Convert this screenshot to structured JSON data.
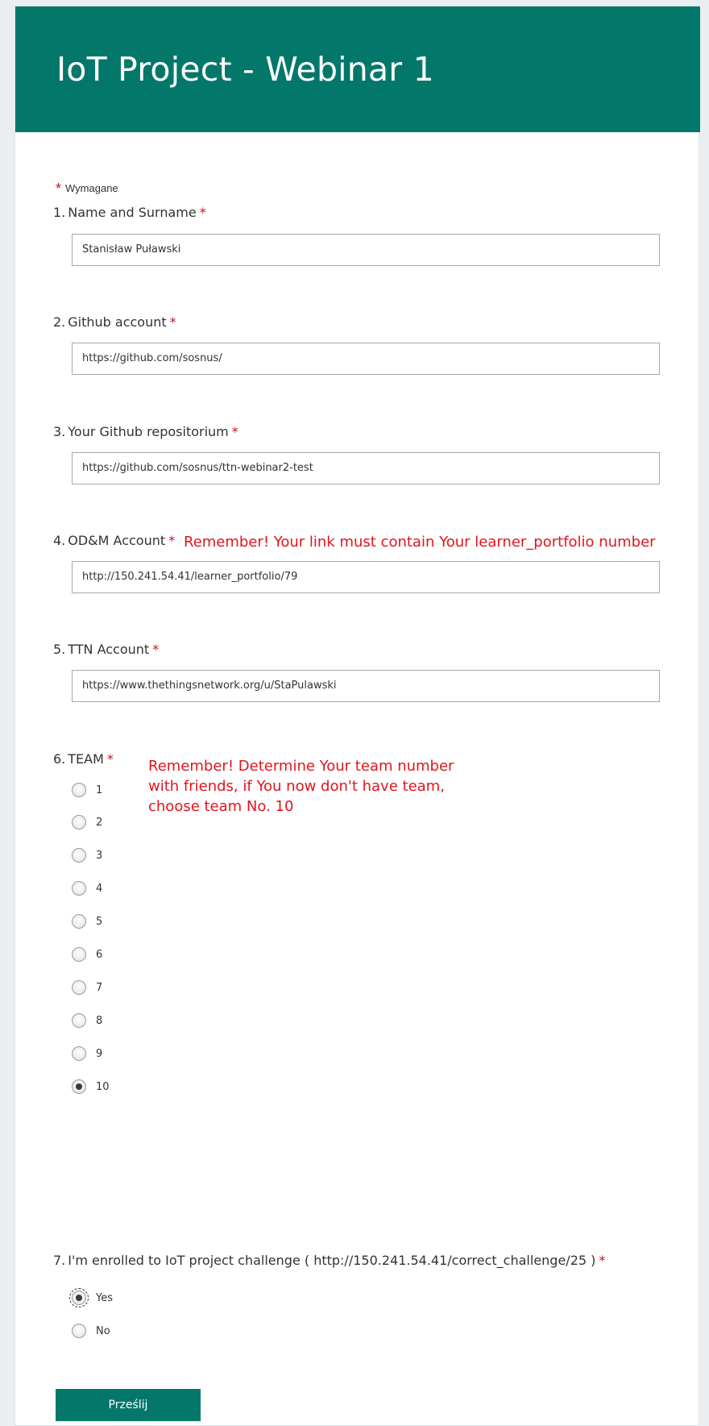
{
  "form": {
    "title": "IoT Project - Webinar 1",
    "required_text": "Wymagane",
    "required_star": "*"
  },
  "questions": [
    {
      "number": "1.",
      "label": "Name and Surname",
      "value": "Stanisław Puławski"
    },
    {
      "number": "2.",
      "label": "Github account",
      "value": "https://github.com/sosnus/"
    },
    {
      "number": "3.",
      "label": "Your Github repositorium",
      "value": "https://github.com/sosnus/ttn-webinar2-test"
    },
    {
      "number": "4.",
      "label": "OD&M Account",
      "value": "http://150.241.54.41/learner_portfolio/79",
      "note": "Remember! Your link must contain Your learner_portfolio number"
    },
    {
      "number": "5.",
      "label": "TTN Account",
      "value": "https://www.thethingsnetwork.org/u/StaPulawski"
    },
    {
      "number": "6.",
      "label": "TEAM",
      "note_lines": [
        "Remember! Determine Your team number",
        "with friends, if You now don't have team,",
        "choose team No. 10"
      ],
      "options": [
        "1",
        "2",
        "3",
        "4",
        "5",
        "6",
        "7",
        "8",
        "9",
        "10"
      ],
      "selected": "10"
    },
    {
      "number": "7.",
      "label": "I'm enrolled to IoT project challenge ( http://150.241.54.41/correct_challenge/25 )",
      "options": [
        "Yes",
        "No"
      ],
      "selected": "Yes"
    }
  ],
  "submit_label": "Prześlij",
  "colors": {
    "header_bg": "#03786a",
    "required_star": "#c4131c",
    "annotation": "#e3141d",
    "submit_bg": "#03786a"
  }
}
